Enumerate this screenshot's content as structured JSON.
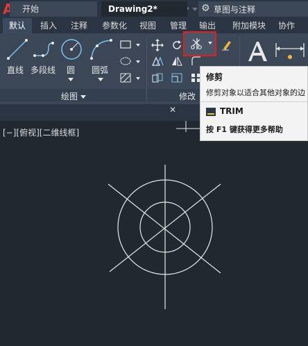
{
  "app": {
    "logo_letter": "A"
  },
  "workspace": {
    "label": "草图与注释"
  },
  "tabs": [
    {
      "label": "默认",
      "active": true
    },
    {
      "label": "插入"
    },
    {
      "label": "注释"
    },
    {
      "label": "参数化"
    },
    {
      "label": "视图"
    },
    {
      "label": "管理"
    },
    {
      "label": "输出"
    },
    {
      "label": "附加模块"
    },
    {
      "label": "协作"
    }
  ],
  "draw_panel": {
    "title": "绘图",
    "tools": {
      "line": "直线",
      "polyline": "多段线",
      "circle": "圆",
      "arc": "圆弧"
    }
  },
  "modify_panel": {
    "title": "修改"
  },
  "doc_tabs": {
    "start": "开始",
    "drawing": "Drawing2*"
  },
  "viewport": {
    "label": "[−][俯视][二维线框]"
  },
  "tooltip": {
    "title": "修剪",
    "description": "修剪对象以适合其他对象的边",
    "command": "TRIM",
    "help": "按 F1 键获得更多帮助"
  },
  "colors": {
    "accent_red": "#e02020",
    "canvas": "#212830",
    "ribbon": "#3b4656"
  }
}
